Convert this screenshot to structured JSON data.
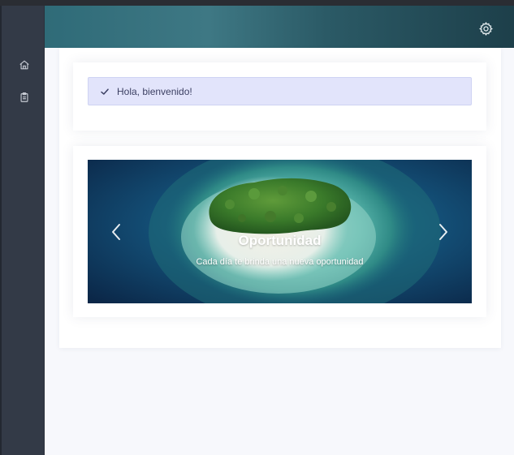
{
  "sidebar": {
    "items": [
      {
        "icon": "home-icon"
      },
      {
        "icon": "clipboard-icon"
      }
    ]
  },
  "header": {
    "settings_icon": "gear-icon"
  },
  "alert": {
    "icon": "check-icon",
    "message": "Hola, bienvenido!"
  },
  "carousel": {
    "slides": [
      {
        "title": "Oportunidad",
        "caption": "Cada día te brinda una nueva oportunidad"
      }
    ],
    "prev_icon": "chevron-left-icon",
    "next_icon": "chevron-right-icon"
  }
}
